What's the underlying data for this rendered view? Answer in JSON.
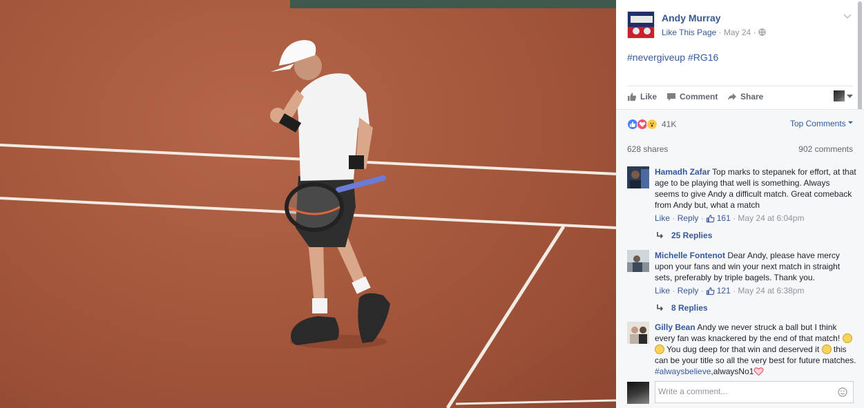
{
  "photo": {
    "alt_subject": "tennis-player-on-clay-court",
    "colors": {
      "clay": "#a85a3e",
      "lines": "#f3efe9",
      "shirt": "#f4f4f4",
      "shorts": "#2d2d2d",
      "racket_handle": "#6a7bd8"
    }
  },
  "post": {
    "page_name": "Andy Murray",
    "like_page": "Like This Page",
    "date": "May 24",
    "separator": "·",
    "text": "#nevergiveup #RG16"
  },
  "actions": {
    "like": "Like",
    "comment": "Comment",
    "share": "Share"
  },
  "stats": {
    "reactions_count": "41K",
    "top_comments": "Top Comments",
    "shares": "628 shares",
    "comments": "902 comments"
  },
  "comments": [
    {
      "author": "Hamadh Zafar",
      "text": "Top marks to stepanek for effort, at that age to be playing that well is something. Always seems to give Andy a difficult match. Great comeback from Andy but, what a match",
      "like": "Like",
      "reply": "Reply",
      "likes": "161",
      "time": "May 24 at 6:04pm",
      "replies": "25 Replies"
    },
    {
      "author": "Michelle Fontenot",
      "text": "Dear Andy, please have mercy upon your fans and win your next match in straight sets, preferably by triple bagels. Thank you.",
      "like": "Like",
      "reply": "Reply",
      "likes": "121",
      "time": "May 24 at 6:38pm",
      "replies": "8 Replies"
    },
    {
      "author": "Gilly Bean",
      "text_a": "Andy we never struck a ball but I think every fan was knackered by the end of that match!",
      "text_b": "You dug deep for that win and deserved it",
      "text_c": "this can be your title so all the very best for future matches.",
      "hashtag": "#alwaysbelieve",
      "text_d": ",alwaysNo1"
    }
  ],
  "composer": {
    "placeholder": "Write a comment..."
  },
  "colors": {
    "link": "#365899",
    "muted": "#90949c",
    "feed_bg": "#f6f7f9"
  }
}
